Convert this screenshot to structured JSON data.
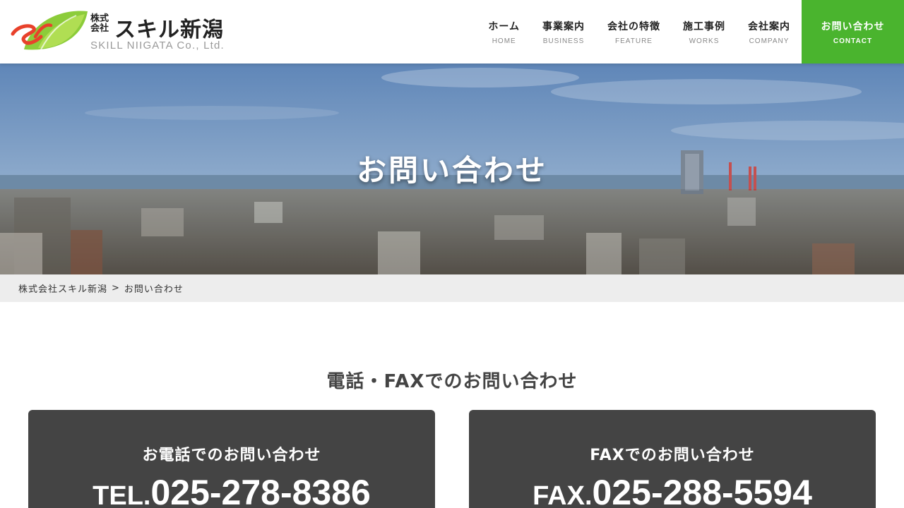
{
  "logo": {
    "kabushiki": "株式会社",
    "name": "スキル新潟",
    "english": "SKILL NIIGATA Co., Ltd."
  },
  "nav": {
    "items": [
      {
        "jp": "ホーム",
        "en": "HOME"
      },
      {
        "jp": "事業案内",
        "en": "BUSINESS"
      },
      {
        "jp": "会社の特徴",
        "en": "FEATURE"
      },
      {
        "jp": "施工事例",
        "en": "WORKS"
      },
      {
        "jp": "会社案内",
        "en": "COMPANY"
      }
    ],
    "contact": {
      "jp": "お問い合わせ",
      "en": "CONTACT"
    }
  },
  "hero": {
    "title": "お問い合わせ"
  },
  "breadcrumb": {
    "home": "株式会社スキル新潟",
    "separator": ">",
    "current": "お問い合わせ"
  },
  "section": {
    "title": "電話・FAXでのお問い合わせ"
  },
  "cards": {
    "tel": {
      "title": "お電話でのお問い合わせ",
      "prefix": "TEL.",
      "number": "025-278-8386"
    },
    "fax": {
      "title": "FAXでのお問い合わせ",
      "prefix": "FAX.",
      "number": "025-288-5594"
    }
  },
  "colors": {
    "accent": "#4ab42e",
    "card_bg": "#444444",
    "breadcrumb_bg": "#ededed"
  }
}
